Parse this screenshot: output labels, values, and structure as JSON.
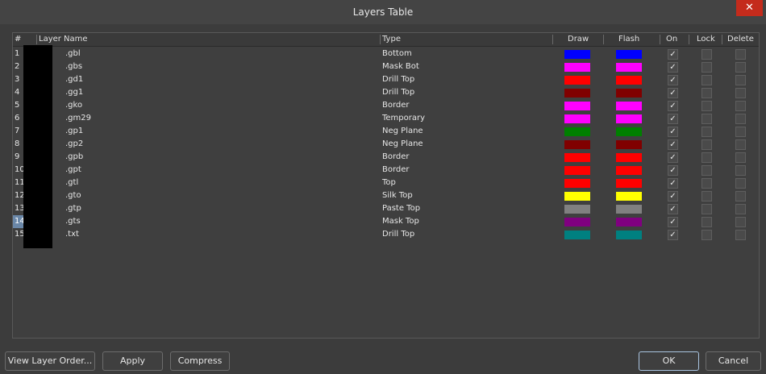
{
  "window": {
    "title": "Layers Table",
    "close": "✕"
  },
  "columns": {
    "num": "#",
    "name": "Layer Name",
    "type": "Type",
    "draw": "Draw",
    "flash": "Flash",
    "on": "On",
    "lock": "Lock",
    "delete": "Delete"
  },
  "rows": [
    {
      "num": "1",
      "name": ".gbl",
      "type": "Bottom",
      "draw": "#0000ff",
      "flash": "#0000ff",
      "on": true
    },
    {
      "num": "2",
      "name": ".gbs",
      "type": "Mask Bot",
      "draw": "#ff00ff",
      "flash": "#ff00ff",
      "on": true
    },
    {
      "num": "3",
      "name": ".gd1",
      "type": "Drill Top",
      "draw": "#ff0000",
      "flash": "#ff0000",
      "on": true
    },
    {
      "num": "4",
      "name": ".gg1",
      "type": "Drill Top",
      "draw": "#800000",
      "flash": "#800000",
      "on": true
    },
    {
      "num": "5",
      "name": ".gko",
      "type": "Border",
      "draw": "#ff00ff",
      "flash": "#ff00ff",
      "on": true
    },
    {
      "num": "6",
      "name": ".gm29",
      "type": "Temporary",
      "draw": "#ff00ff",
      "flash": "#ff00ff",
      "on": true
    },
    {
      "num": "7",
      "name": ".gp1",
      "type": "Neg Plane",
      "draw": "#008000",
      "flash": "#008000",
      "on": true
    },
    {
      "num": "8",
      "name": ".gp2",
      "type": "Neg Plane",
      "draw": "#800000",
      "flash": "#800000",
      "on": true
    },
    {
      "num": "9",
      "name": ".gpb",
      "type": "Border",
      "draw": "#ff0000",
      "flash": "#ff0000",
      "on": true
    },
    {
      "num": "10",
      "name": ".gpt",
      "type": "Border",
      "draw": "#ff0000",
      "flash": "#ff0000",
      "on": true
    },
    {
      "num": "11",
      "name": ".gtl",
      "type": "Top",
      "draw": "#ff0000",
      "flash": "#ff0000",
      "on": true
    },
    {
      "num": "12",
      "name": ".gto",
      "type": "Silk Top",
      "draw": "#ffff00",
      "flash": "#ffff00",
      "on": true
    },
    {
      "num": "13",
      "name": ".gtp",
      "type": "Paste Top",
      "draw": "#808080",
      "flash": "#808080",
      "on": true
    },
    {
      "num": "14",
      "name": ".gts",
      "type": "Mask Top",
      "draw": "#800080",
      "flash": "#800080",
      "on": true,
      "selected": true
    },
    {
      "num": "15",
      "name": ".txt",
      "type": "Drill Top",
      "draw": "#008080",
      "flash": "#008080",
      "on": true
    }
  ],
  "buttons": {
    "view_layer_order": "View Layer Order...",
    "apply": "Apply",
    "compress": "Compress",
    "ok": "OK",
    "cancel": "Cancel"
  },
  "check_glyph": "✓"
}
